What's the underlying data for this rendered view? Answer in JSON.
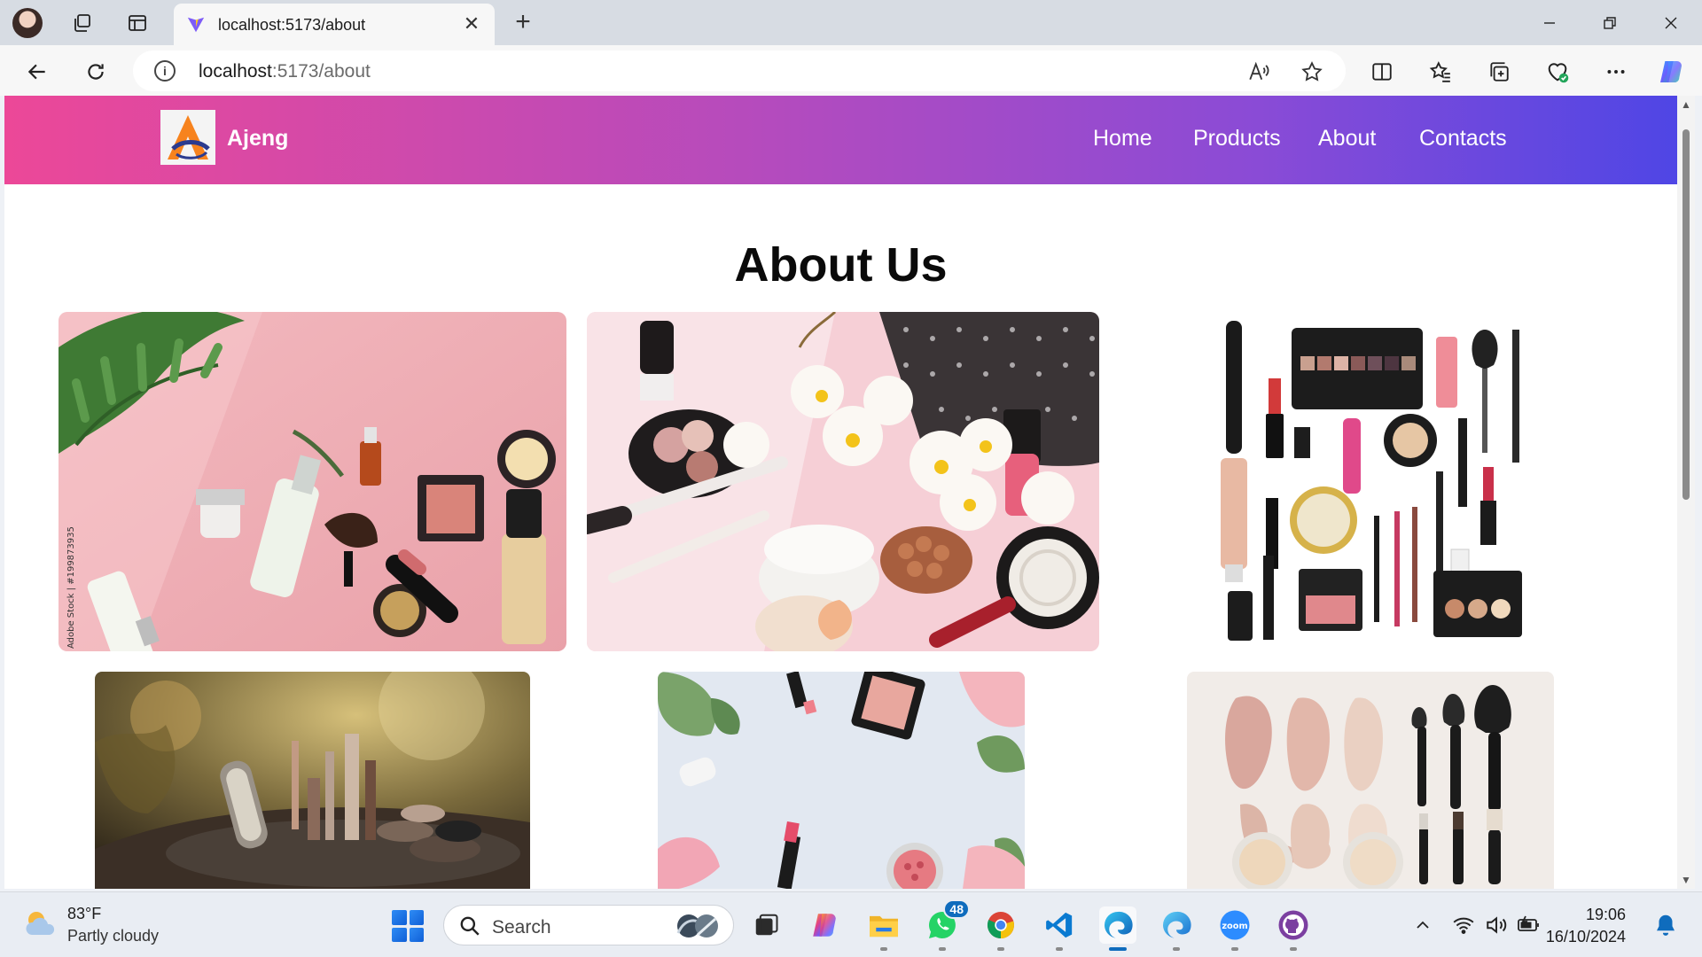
{
  "browser": {
    "tab": {
      "title": "localhost:5173/about"
    },
    "address": {
      "host": "localhost",
      "path": ":5173/about"
    }
  },
  "site": {
    "brand": "Ajeng",
    "nav": [
      "Home",
      "Products",
      "About",
      "Contacts"
    ],
    "page_title": "About Us"
  },
  "taskbar": {
    "weather": {
      "temp": "83°F",
      "desc": "Partly cloudy"
    },
    "search_label": "Search",
    "whatsapp_badge": "48",
    "clock": {
      "time": "19:06",
      "date": "16/10/2024"
    },
    "zoom_label": "zoom"
  },
  "photo_watermark": "Adobe Stock | #199873935",
  "colors": {
    "header_gradient": [
      "#ec4898",
      "#b54bbd",
      "#8a4bd6",
      "#4f46e5"
    ],
    "accent": "#0f6cbd"
  },
  "icons": {
    "browser_toolbar": [
      "read-aloud-icon",
      "favorites-star-icon",
      "split-screen-icon",
      "favorites-icon",
      "collections-icon",
      "browser-essentials-icon",
      "more-icon",
      "copilot-icon"
    ],
    "taskbar_apps": [
      "task-view-icon",
      "copilot-icon",
      "file-explorer-icon",
      "whatsapp-icon",
      "chrome-icon",
      "vscode-icon",
      "edge-icon",
      "edge-beta-icon",
      "zoom-icon",
      "github-desktop-icon"
    ]
  }
}
